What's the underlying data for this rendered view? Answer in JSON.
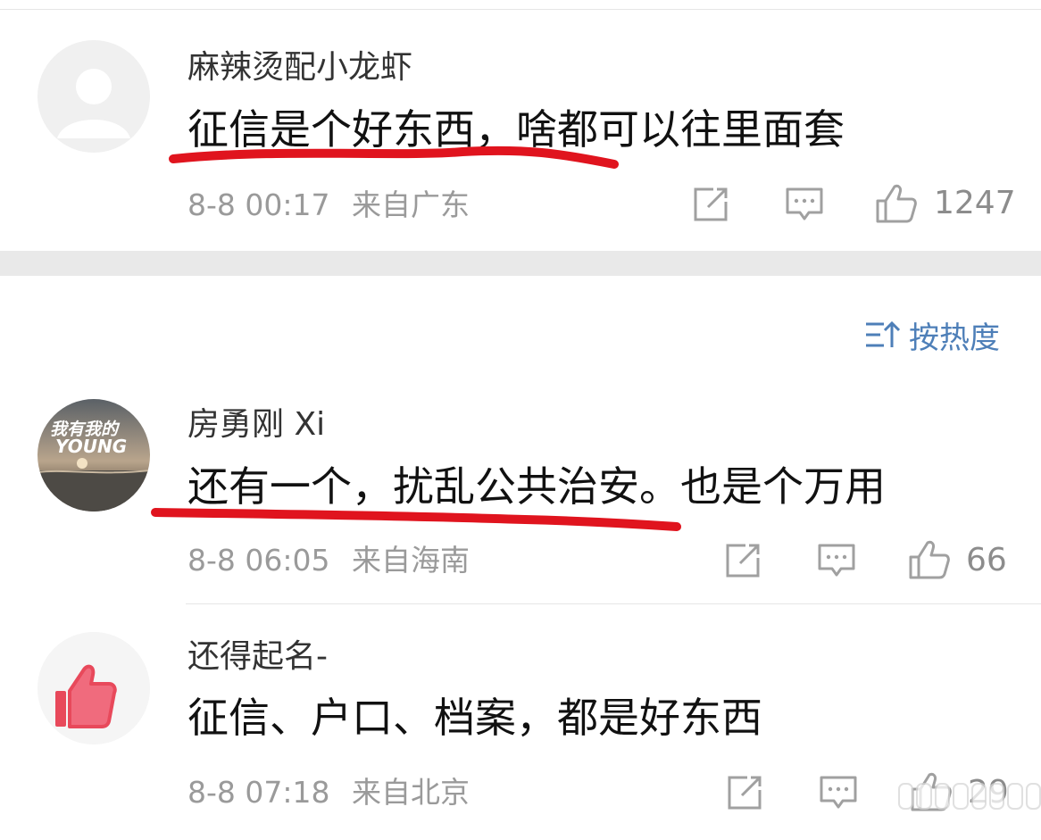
{
  "comments": [
    {
      "username": "麻辣烫配小龙虾",
      "content": "征信是个好东西，啥都可以往里面套",
      "time": "8-8 00:17",
      "location": "来自广东",
      "likes": "1247",
      "avatar": "default-person-avatar"
    },
    {
      "username": "房勇刚 Xi",
      "content": "还有一个，扰乱公共治安。也是个万用",
      "time": "8-8 06:05",
      "location": "来自海南",
      "likes": "66",
      "avatar": "sunset-beach-photo-avatar",
      "avatar_text": "我有我的YOUNG"
    },
    {
      "username": "还得起名-",
      "content": "征信、户口、档案，都是好东西",
      "time": "8-8 07:18",
      "location": "来自北京",
      "likes": "29",
      "avatar": "thumbs-up-avatar"
    }
  ],
  "sort": {
    "label": "按热度"
  },
  "colors": {
    "accent": "#4e7fb8",
    "underline": "#e0141e",
    "meta": "#9a9a9a",
    "icon": "#a0a0a0"
  }
}
